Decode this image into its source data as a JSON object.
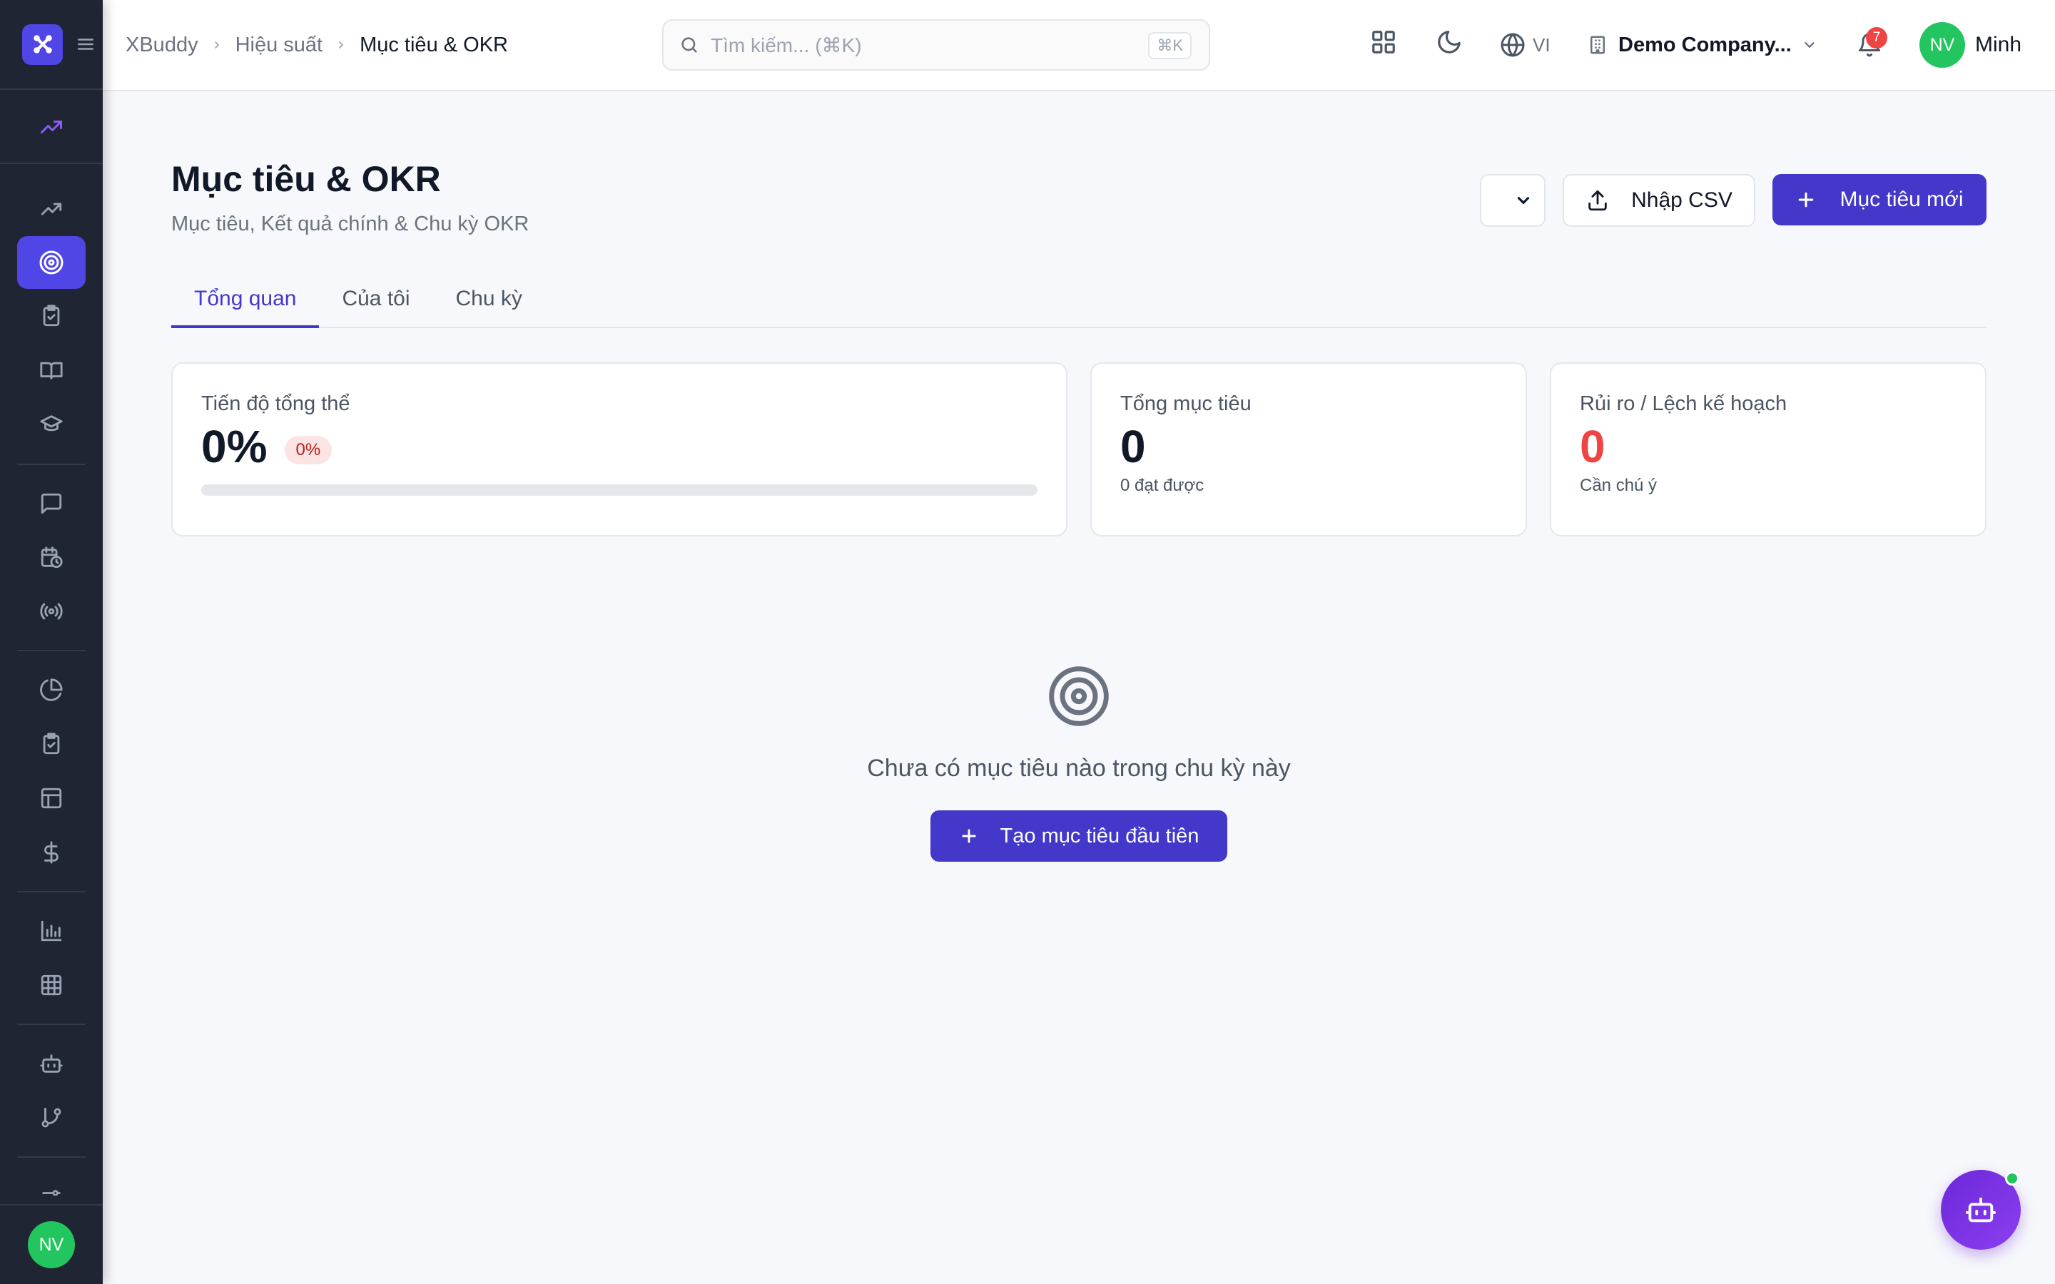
{
  "sidebar": {
    "user_initials": "NV",
    "icons": [
      "trend-up-icon",
      "trend-up-icon",
      "target-icon",
      "clipboard-check-icon",
      "book-open-icon",
      "graduation-cap-icon",
      "message-square-icon",
      "calendar-clock-icon",
      "broadcast-icon",
      "pie-chart-icon",
      "clipboard-check-icon",
      "layout-icon",
      "dollar-icon",
      "bar-chart-icon",
      "table-grid-icon",
      "bot-icon",
      "git-branch-icon",
      "sliders-icon"
    ]
  },
  "header": {
    "breadcrumb": [
      "XBuddy",
      "Hiệu suất",
      "Mục tiêu & OKR"
    ],
    "search_placeholder": "Tìm kiếm... (⌘K)",
    "search_shortcut": "⌘K",
    "language": "VI",
    "company": "Demo Company...",
    "notification_count": "7",
    "user_initials": "NV",
    "user_name": "Minh"
  },
  "page": {
    "title": "Mục tiêu & OKR",
    "subtitle": "Mục tiêu, Kết quả chính & Chu kỳ OKR",
    "import_label": "Nhập CSV",
    "new_label": "Mục tiêu mới"
  },
  "tabs": [
    "Tổng quan",
    "Của tôi",
    "Chu kỳ"
  ],
  "stats": {
    "progress": {
      "label": "Tiến độ tổng thể",
      "value": "0%",
      "badge": "0%",
      "fraction": 0
    },
    "total": {
      "label": "Tổng mục tiêu",
      "value": "0",
      "foot": "0 đạt được"
    },
    "risk": {
      "label": "Rủi ro / Lệch kế hoạch",
      "value": "0",
      "foot": "Cần chú ý"
    }
  },
  "empty": {
    "message": "Chưa có mục tiêu nào trong chu kỳ này",
    "cta": "Tạo mục tiêu đầu tiên"
  },
  "colors": {
    "accent": "#4338ca",
    "sidebar": "#1f2532",
    "danger": "#ef4444",
    "success": "#22c55e"
  }
}
